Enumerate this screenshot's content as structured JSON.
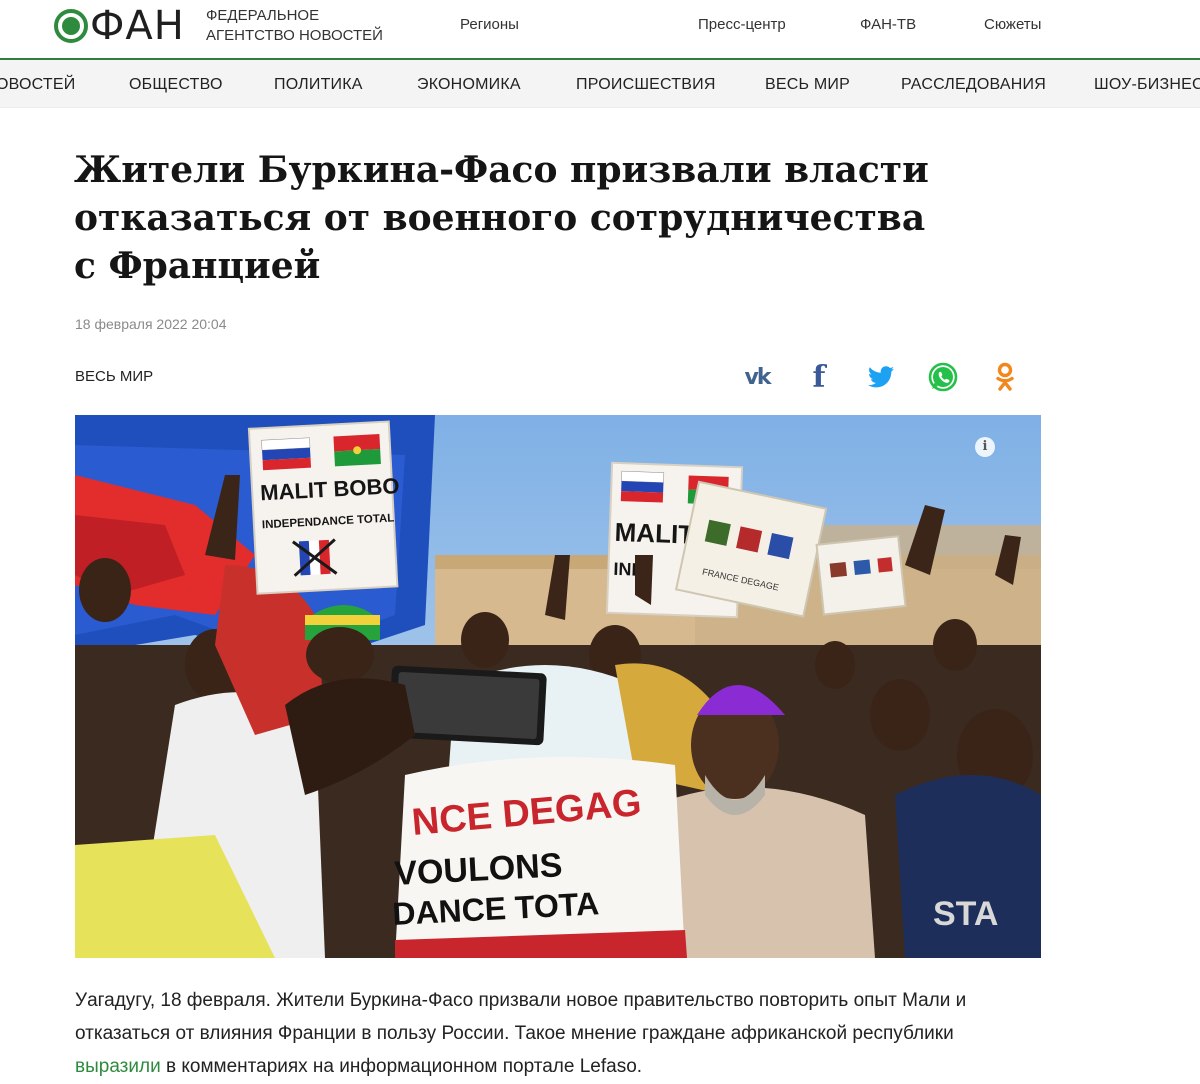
{
  "header": {
    "logo_text": "ФАН",
    "tagline_line1": "ФЕДЕРАЛЬНОЕ",
    "tagline_line2": "АГЕНТСТВО НОВОСТЕЙ",
    "nav": [
      "Регионы",
      "Пресс-центр",
      "ФАН-ТВ",
      "Сюжеты"
    ],
    "accent_color": "#2e7d3a"
  },
  "rubrics": [
    "ОВОСТЕЙ",
    "ОБЩЕСТВО",
    "ПОЛИТИКА",
    "ЭКОНОМИКА",
    "ПРОИСШЕСТВИЯ",
    "ВЕСЬ МИР",
    "РАССЛЕДОВАНИЯ",
    "ШОУ-БИЗНЕС"
  ],
  "article": {
    "title": "Жители Буркина-Фасо призвали власти отказаться от военного сотрудничества с Францией",
    "date": "18 февраля 2022 20:04",
    "section": "ВЕСЬ МИР",
    "share_icons": [
      "vk-icon",
      "facebook-icon",
      "twitter-icon",
      "whatsapp-icon",
      "odnoklassniki-icon"
    ],
    "photo": {
      "sign1_line1": "MALIT BOBO",
      "sign1_line2": "INDEPENDANCE TOTAL",
      "sign2_text": "MALIT",
      "sign2_text2": "IND",
      "sign3_text": "FRANCE DEGAGE",
      "banner_line1": "NCE DEGAG",
      "banner_line2": "VOULONS",
      "banner_line3": "DANCE TOTA",
      "shirt_text": "STA",
      "info_icon": "i"
    },
    "lead_before_link": "Уагадугу, 18 февраля. Жители Буркина-Фасо призвали новое правительство повторить опыт Мали и отказаться от влияния Франции в пользу России. Такое мнение граждане африканской республики ",
    "lead_link": "выразили",
    "lead_after_link": " в комментариях на информационном портале Lefaso."
  }
}
